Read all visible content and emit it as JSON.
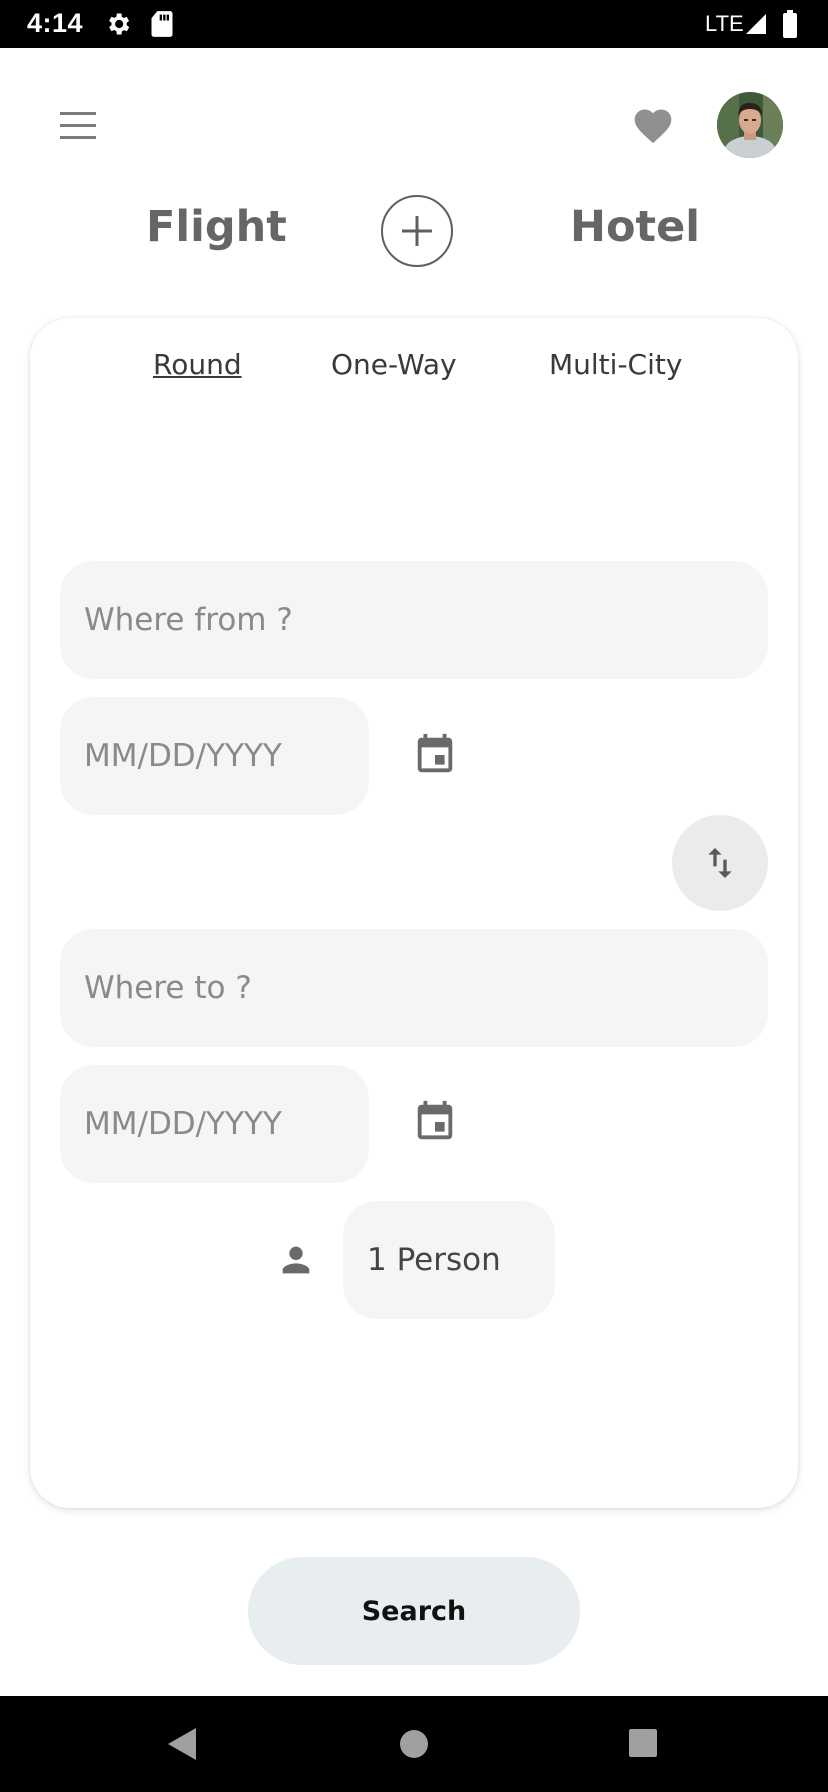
{
  "status_bar": {
    "time": "4:14",
    "network": "LTE",
    "icons": [
      "settings-icon",
      "sd-card-icon",
      "signal-icon",
      "battery-icon"
    ]
  },
  "header": {
    "icons": [
      "menu-icon",
      "heart-icon",
      "avatar"
    ]
  },
  "mode": {
    "left_label": "Flight",
    "right_label": "Hotel",
    "center_icon": "plus-icon"
  },
  "trip_types": {
    "selected": "Round",
    "options": [
      "Round",
      "One-Way",
      "Multi-City"
    ]
  },
  "form": {
    "from_placeholder": "Where from ?",
    "depart_date_placeholder": "MM/DD/YYYY",
    "to_placeholder": "Where to ?",
    "return_date_placeholder": "MM/DD/YYYY",
    "persons_value": "1 Person"
  },
  "actions": {
    "search_label": "Search"
  },
  "colors": {
    "accent_gray": "#666666",
    "field_bg": "#f5f5f5",
    "search_bg": "#e8eef0"
  }
}
